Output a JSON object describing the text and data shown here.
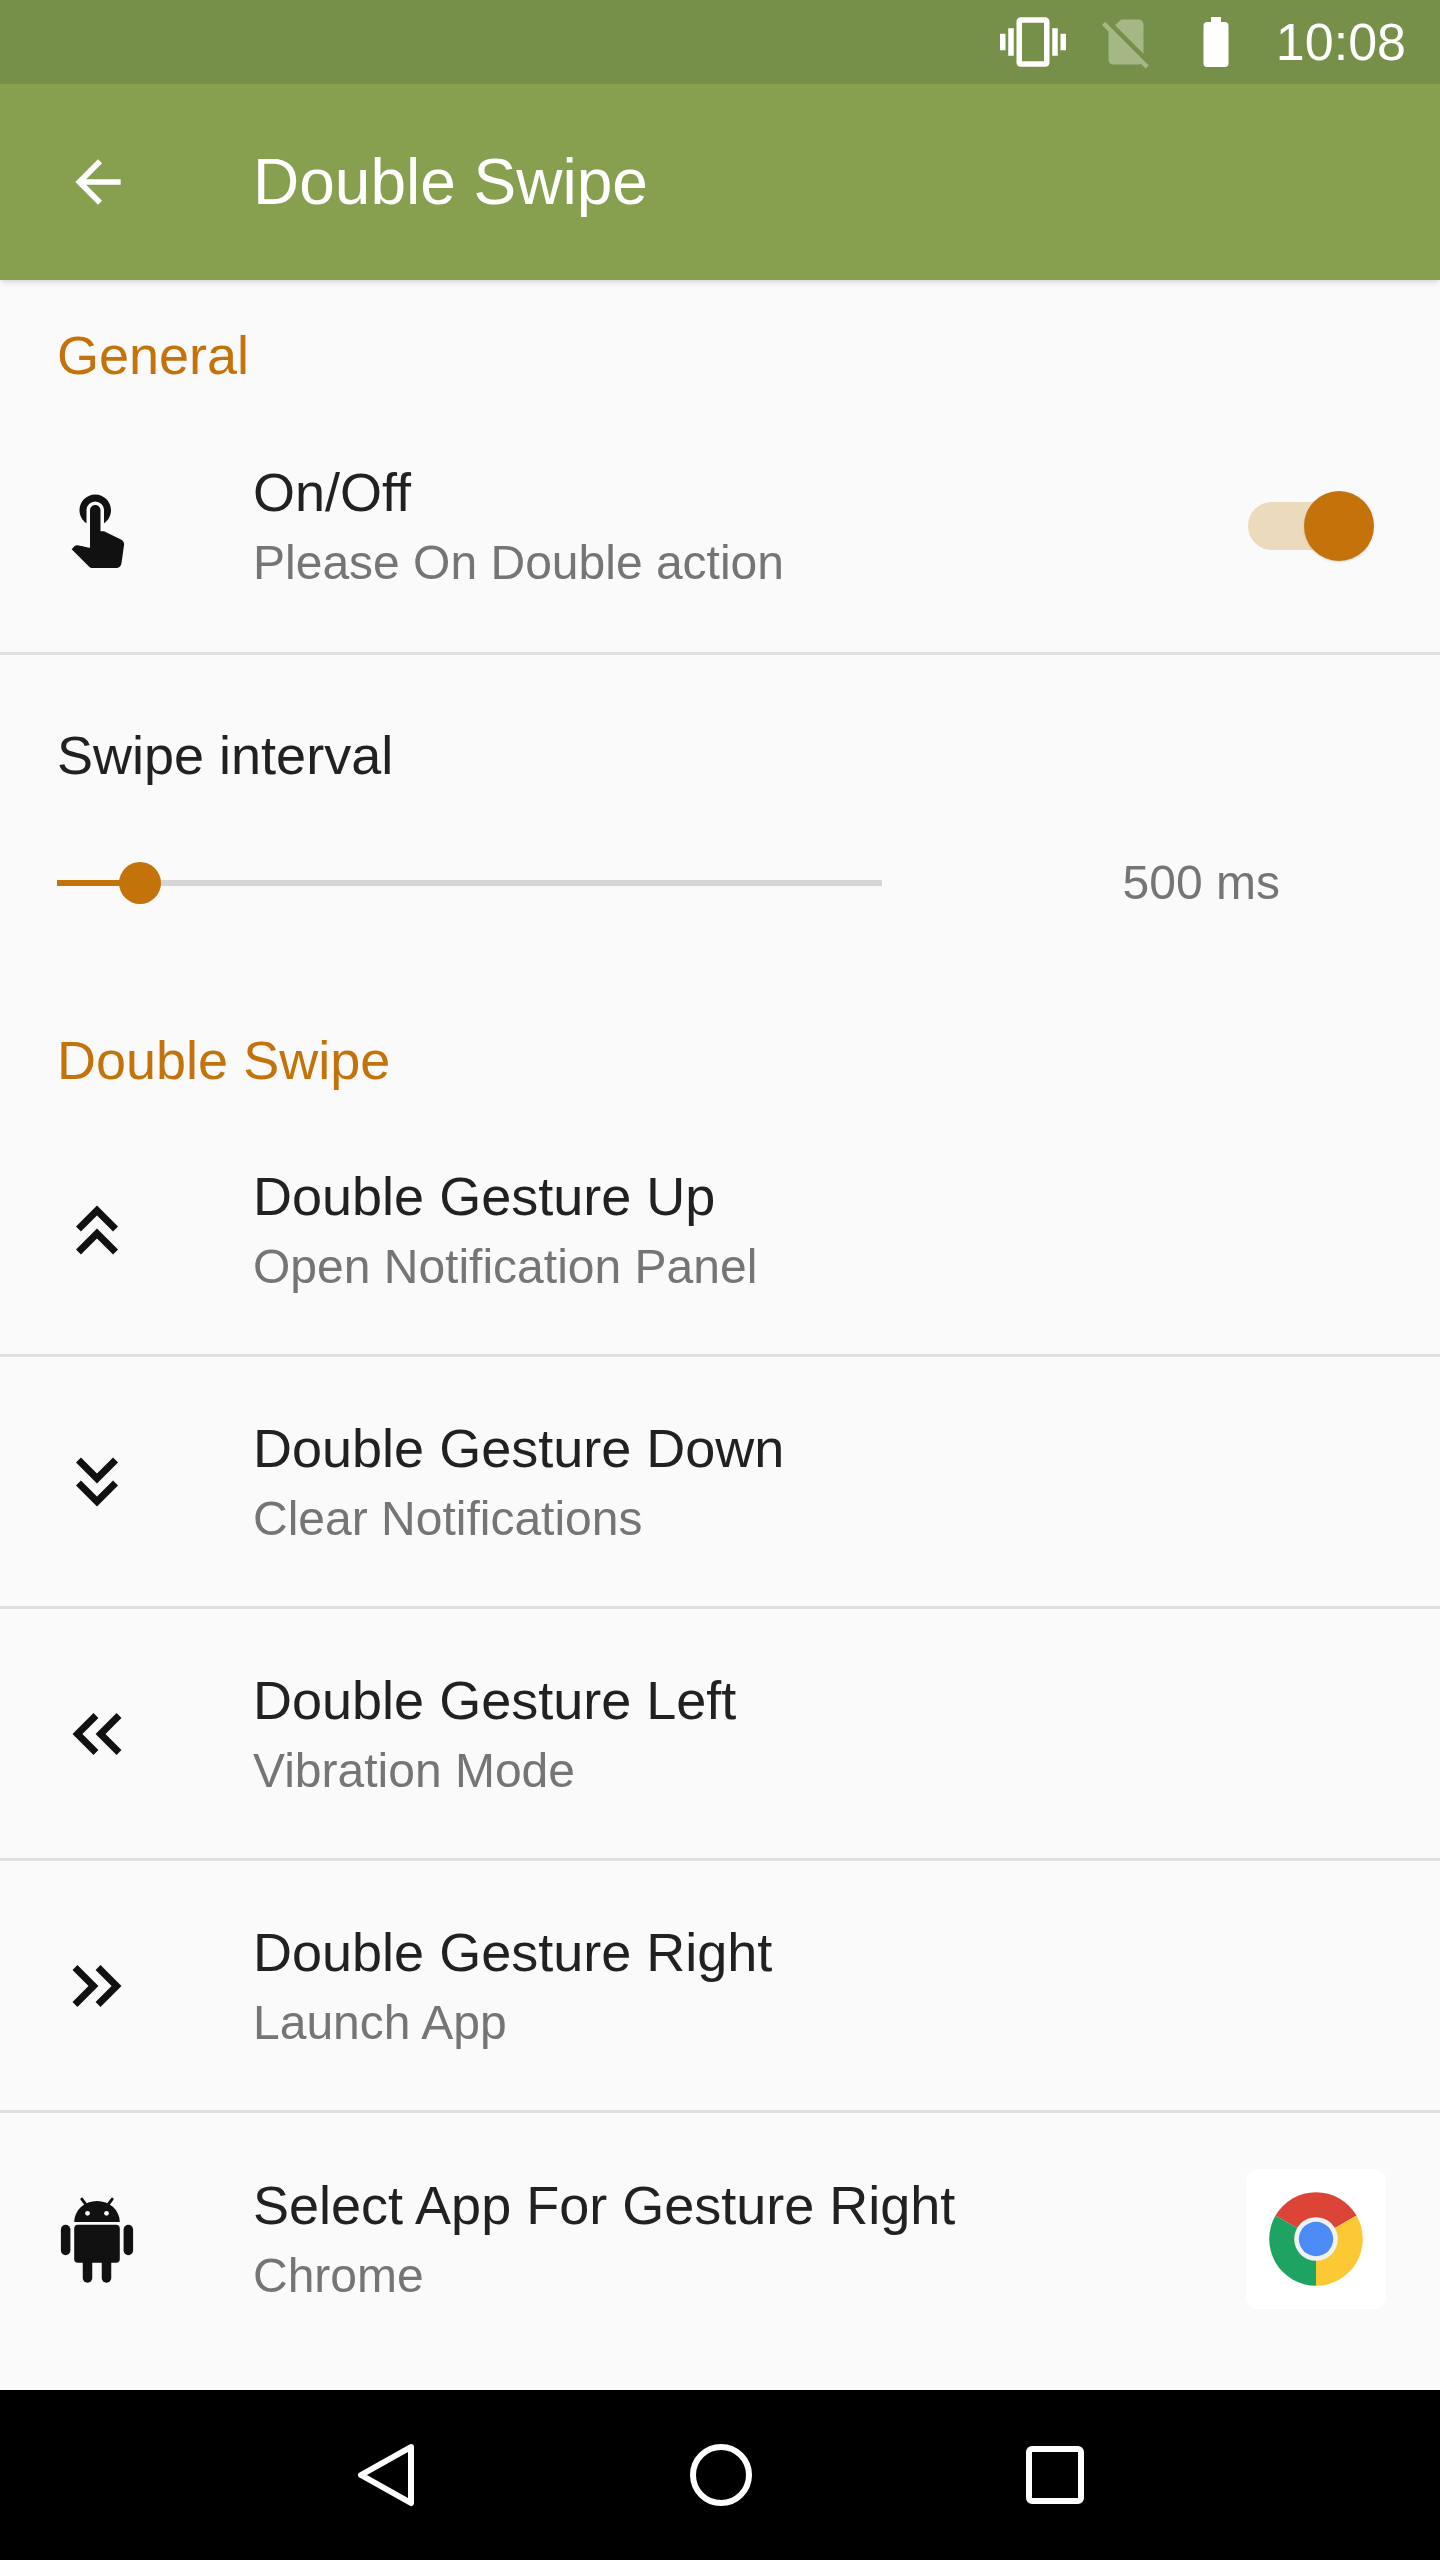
{
  "status_bar": {
    "time": "10:08"
  },
  "app_bar": {
    "title": "Double Swipe"
  },
  "sections": [
    {
      "header": "General",
      "items": [
        {
          "kind": "switch",
          "title": "On/Off",
          "subtitle": "Please On Double action",
          "on": true
        },
        {
          "kind": "slider",
          "title": "Swipe interval",
          "level": 0.1,
          "reading": "500 ms"
        }
      ]
    },
    {
      "header": "Double Swipe",
      "items": [
        {
          "kind": "action",
          "title": "Double Gesture Up",
          "subtitle": "Open Notification Panel"
        },
        {
          "kind": "action",
          "title": "Double Gesture Down",
          "subtitle": "Clear Notifications"
        },
        {
          "kind": "action",
          "title": "Double Gesture Left",
          "subtitle": "Vibration Mode"
        },
        {
          "kind": "action",
          "title": "Double Gesture Right",
          "subtitle": "Launch App"
        },
        {
          "kind": "app",
          "title": "Select App For Gesture Right",
          "subtitle": "Chrome"
        }
      ]
    }
  ]
}
